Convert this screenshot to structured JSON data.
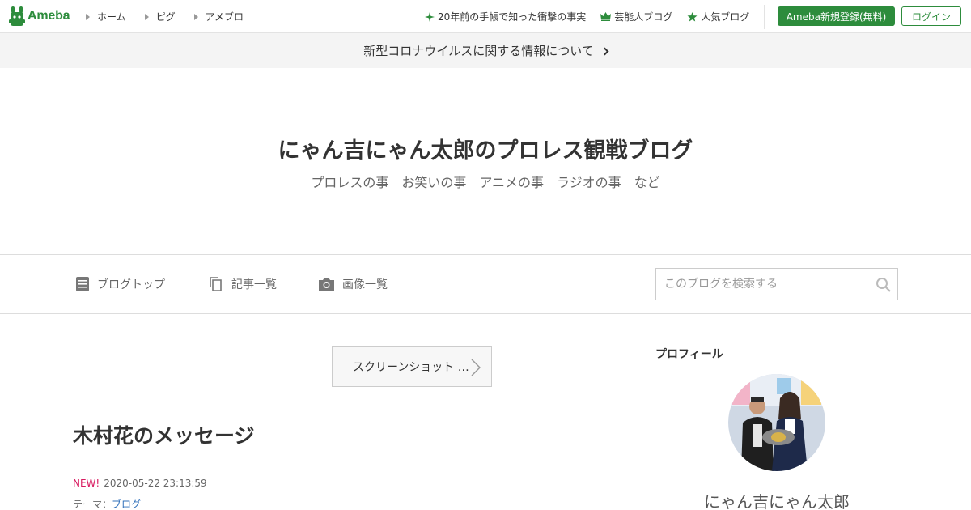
{
  "header": {
    "logo_text": "Ameba",
    "nav": [
      {
        "label": "ホーム"
      },
      {
        "label": "ピグ"
      },
      {
        "label": "アメブロ"
      }
    ],
    "right_links": [
      {
        "label": "20年前の手帳で知った衝撃の事実",
        "icon": "sparkle-icon"
      },
      {
        "label": "芸能人ブログ",
        "icon": "crown-icon"
      },
      {
        "label": "人気ブログ",
        "icon": "star-icon"
      }
    ],
    "register_label": "Ameba新規登録(無料)",
    "login_label": "ログイン",
    "accent_color": "#2d8c3c"
  },
  "notice": {
    "text": "新型コロナウイルスに関する情報について"
  },
  "blog": {
    "title": "にゃん吉にゃん太郎のプロレス観戦ブログ",
    "description": "プロレスの事　お笑いの事　アニメの事　ラジオの事　など"
  },
  "blog_nav": {
    "items": [
      {
        "label": "ブログトップ",
        "icon": "document-icon"
      },
      {
        "label": "記事一覧",
        "icon": "copy-icon"
      },
      {
        "label": "画像一覧",
        "icon": "camera-icon"
      }
    ],
    "search_placeholder": "このブログを検索する"
  },
  "main": {
    "screenshot_label": "スクリーンショット …",
    "entry_title": "木村花のメッセージ",
    "new_badge": "NEW!",
    "datetime": "2020-05-22 23:13:59",
    "theme_prefix": "テーマ：",
    "theme_link": "ブログ"
  },
  "sidebar": {
    "profile_heading": "プロフィール",
    "profile_name": "にゃん吉にゃん太郎"
  }
}
